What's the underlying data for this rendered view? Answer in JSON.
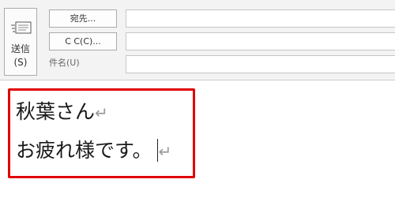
{
  "header": {
    "send_label": "送信",
    "send_shortcut": "(S)",
    "to_button_label": "宛先...",
    "cc_button_label": "C C(C)...",
    "subject_label": "件名(U)",
    "to_value": "",
    "cc_value": "",
    "subject_value": ""
  },
  "body": {
    "line1": "秋葉さん",
    "line2": "お疲れ様です。",
    "paragraph_mark": "↵"
  },
  "colors": {
    "highlight_border": "#e00000",
    "header_background": "#f3f3f3"
  },
  "icons": {
    "send": "send-envelope-icon",
    "paragraph": "paragraph-return-mark"
  }
}
